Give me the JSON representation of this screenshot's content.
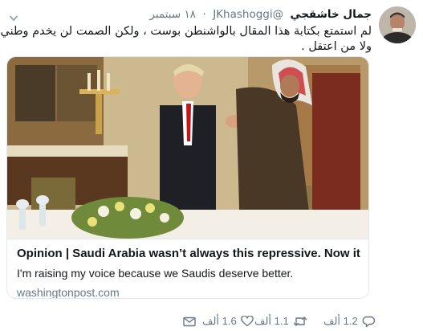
{
  "tweet": {
    "author_name": "جمال خاشقجي",
    "handle": "@JKhashoggi",
    "separator": "·",
    "date": "١٨ سبتمبر",
    "text_line1": "لم استمتع بكتابة هذا المقال بالواشنطن بوست ، ولكن الصمت لن يخدم وطني",
    "text_line2": "ولا من اعتقل ."
  },
  "card": {
    "title": "Opinion | Saudi Arabia wasn’t always this repressive. Now it’s un...",
    "description": "I'm raising my voice because we Saudis deserve better.",
    "domain": "washingtonpost.com"
  },
  "actions": {
    "reply_count": "1.2 ألف",
    "retweet_count": "1.1 ألف",
    "like_count": "1.6 ألف"
  },
  "colors": {
    "text": "#14171a",
    "muted": "#657786",
    "border": "#e1e8ed"
  },
  "icons": {
    "reply": "reply-icon",
    "retweet": "retweet-icon",
    "like": "heart-icon",
    "message": "envelope-icon",
    "menu": "chevron-down-icon"
  }
}
